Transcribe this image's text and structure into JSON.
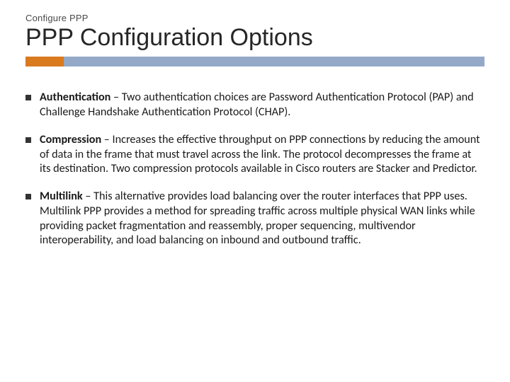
{
  "header": {
    "pretitle": "Configure PPP",
    "title": "PPP Configuration Options"
  },
  "bullets": [
    {
      "term": "Authentication",
      "desc": " – Two authentication choices are Password Authentication Protocol (PAP) and Challenge Handshake Authentication Protocol (CHAP)."
    },
    {
      "term": "Compression",
      "desc": " – Increases the effective throughput on PPP connections by reducing the amount of data in the frame that must travel across the link. The protocol decompresses the frame at its destination. Two compression protocols available in Cisco routers are Stacker and Predictor."
    },
    {
      "term": "Multilink",
      "desc": " – This alternative provides load balancing over the router interfaces that PPP uses. Multilink PPP provides a method for spreading traffic across multiple physical WAN links while providing packet fragmentation and reassembly, proper sequencing, multivendor interoperability, and load balancing on inbound and outbound traffic."
    }
  ]
}
